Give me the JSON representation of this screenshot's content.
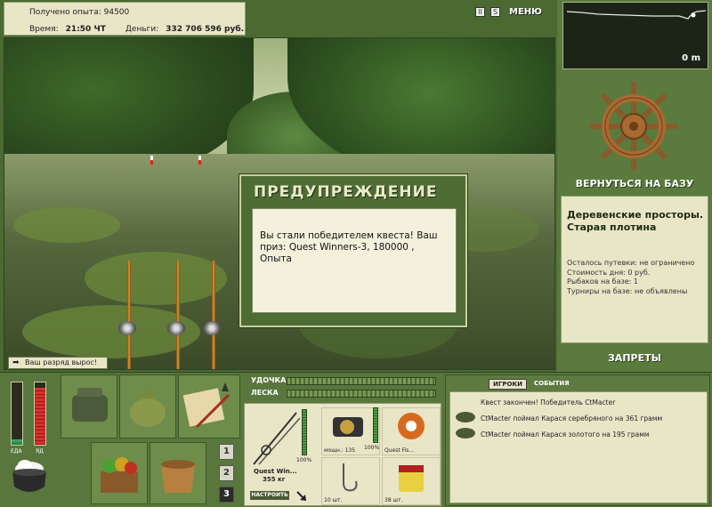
{
  "top_info": {
    "exp_label": "Получено опыта:",
    "exp_value": "94500",
    "time_label": "Время:",
    "time_value": "21:50 ЧТ",
    "money_label": "Деньги:",
    "money_value": "332 706 596 руб."
  },
  "top_icons": {
    "pause_icon": "II",
    "sound_icon": "S",
    "menu_label": "МЕНЮ"
  },
  "depth": {
    "value": "0 m"
  },
  "scene": {
    "rank_message": "Ваш разряд вырос!"
  },
  "dialog": {
    "title": "ПРЕДУПРЕЖДЕНИЕ",
    "message": "Вы стали победителем квеста! Ваш приз: Quest Winners-3, 180000 , Опыта"
  },
  "right_panel": {
    "return_label": "ВЕРНУТЬСЯ НА БАЗУ",
    "location_name": "Деревенские просторы. Старая плотина",
    "stats": [
      "Осталось путевки: не ограничено",
      "Стоимость дня: 0 руб.",
      "Рыбаков на базе: 1",
      "Турниры на базе: не объявлены"
    ],
    "bans_label": "ЗАПРЕТЫ"
  },
  "status": {
    "food_label": "ЕДА",
    "poison_label": "ЯД",
    "food_level": 0.08,
    "poison_level": 0.92
  },
  "inventory": {
    "pages": [
      "1",
      "2",
      "3"
    ],
    "active_page": 2
  },
  "tackle": {
    "rod_label": "УДОЧКА",
    "line_label": "ЛЕСКА",
    "rod_name": "Quest Win...",
    "rod_weight": "355 кг",
    "rod_condition": "100%",
    "reel_power": "мощн.: 135",
    "reel_condition": "100%",
    "line_name": "Quest Fis...",
    "hooks_count": "10 шт.",
    "bait_count": "38 шт.",
    "setup_label": "НАСТРОИТЬ"
  },
  "events": {
    "tabs": [
      "ИГРОКИ",
      "СОБЫТИЯ"
    ],
    "items": [
      "Квест закончен! Победитель CtMacter",
      "CtMacter поймал Карася серебряного на 361 грамм",
      "CtMacter поймал Карася золотого на 195 грамм"
    ]
  },
  "colors": {
    "panel_bg": "#e9e6c8",
    "frame_green": "#59773d",
    "dialog_green": "#4e6c35"
  }
}
